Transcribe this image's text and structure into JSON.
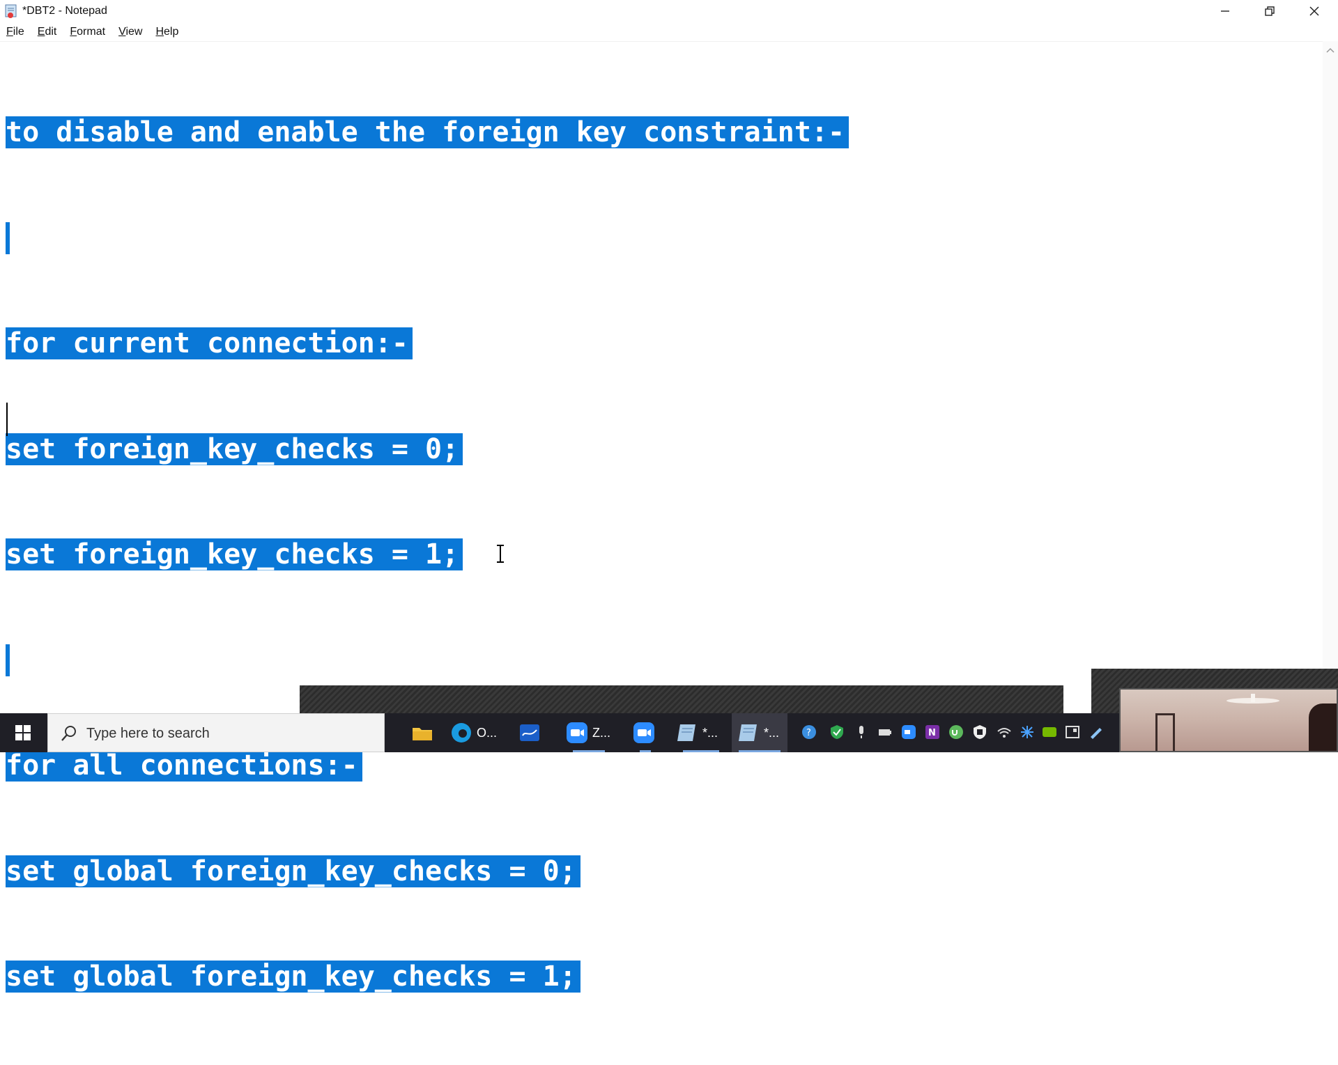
{
  "window": {
    "title": "*DBT2 - Notepad"
  },
  "menu": [
    {
      "key": "F",
      "rest": "ile"
    },
    {
      "key": "E",
      "rest": "dit"
    },
    {
      "key": "F",
      "rest": "ormat"
    },
    {
      "key": "V",
      "rest": "iew"
    },
    {
      "key": "H",
      "rest": "elp"
    }
  ],
  "editor": {
    "lines": [
      "to disable and enable the foreign key constraint:-",
      "",
      "for current connection:-",
      "set foreign_key_checks = 0;",
      "set foreign_key_checks = 1;",
      "",
      "for all connections:-",
      "set global foreign_key_checks = 0;",
      "set global foreign_key_checks = 1;"
    ],
    "selection_color": "#0a78d7"
  },
  "taskbar": {
    "search_placeholder": "Type here to search",
    "apps": [
      {
        "name": "file-explorer",
        "label": ""
      },
      {
        "name": "edge",
        "label": "O..."
      },
      {
        "name": "whiteboard",
        "label": ""
      },
      {
        "name": "zoom",
        "label": "Z..."
      },
      {
        "name": "zoom-meeting",
        "label": ""
      },
      {
        "name": "notepad-1",
        "label": "*..."
      },
      {
        "name": "notepad-2",
        "label": "*..."
      }
    ]
  }
}
